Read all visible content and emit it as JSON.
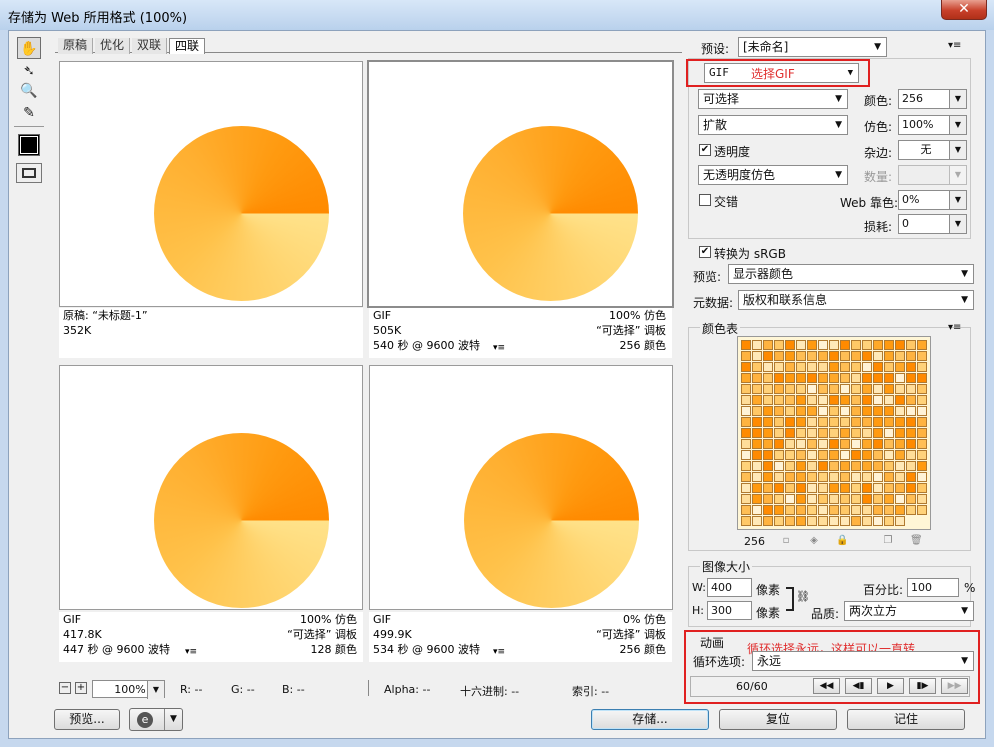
{
  "window": {
    "title": "存储为 Web 所用格式 (100%)",
    "close": "✕"
  },
  "tabs": [
    "原稿",
    "优化",
    "双联",
    "四联"
  ],
  "panes": [
    {
      "line1_left": "原稿: “未标题-1”",
      "line1_right": "",
      "line2_left": "352K",
      "line2_right": "",
      "line3_left": "",
      "line3_right": ""
    },
    {
      "line1_left": "GIF",
      "line1_right": "100% 仿色",
      "line2_left": "505K",
      "line2_right": "“可选择” 调板",
      "line3_left": "540 秒 @ 9600 波特",
      "line3_right": "256 颜色"
    },
    {
      "line1_left": "GIF",
      "line1_right": "100% 仿色",
      "line2_left": "417.8K",
      "line2_right": "“可选择” 调板",
      "line3_left": "447 秒 @ 9600 波特",
      "line3_right": "128 颜色"
    },
    {
      "line1_left": "GIF",
      "line1_right": "0% 仿色",
      "line2_left": "499.9K",
      "line2_right": "“可选择” 调板",
      "line3_left": "534 秒 @ 9600 波特",
      "line3_right": "256 颜色"
    }
  ],
  "status": {
    "zoom": "100%",
    "r": "R: --",
    "g": "G: --",
    "b": "B: --",
    "alpha": "Alpha: --",
    "hex": "十六进制: --",
    "index": "索引: --"
  },
  "buttons": {
    "preview": "预览...",
    "save": "存储...",
    "reset": "复位",
    "remember": "记住"
  },
  "settings": {
    "preset_label": "预设:",
    "preset_value": "[未命名]",
    "format_value": "GIF",
    "format_note": "选择GIF",
    "reduction": "可选择",
    "dither_algo": "扩散",
    "colors_label": "颜色:",
    "colors_value": "256",
    "dither_label": "仿色:",
    "dither_value": "100%",
    "transparency_label": "透明度",
    "matte_label": "杂边:",
    "matte_value": "无",
    "trans_dither": "无透明度仿色",
    "amount_label": "数量:",
    "interlaced_label": "交错",
    "websnap_label": "Web 靠色:",
    "websnap_value": "0%",
    "lossy_label": "损耗:",
    "lossy_value": "0",
    "convert_srgb": "转换为 sRGB",
    "preview_label": "预览:",
    "preview_value": "显示器颜色",
    "metadata_label": "元数据:",
    "metadata_value": "版权和联系信息"
  },
  "color_table": {
    "title": "颜色表",
    "count": "256"
  },
  "image_size": {
    "title": "图像大小",
    "w_label": "W:",
    "w_value": "400",
    "h_label": "H:",
    "h_value": "300",
    "unit": "像素",
    "percent_label": "百分比:",
    "percent_value": "100",
    "percent_unit": "%",
    "quality_label": "品质:",
    "quality_value": "两次立方"
  },
  "animation": {
    "title": "动画",
    "note": "循环选择永远，这样可以一直转",
    "loop_label": "循环选项:",
    "loop_value": "永远",
    "frame": "60/60"
  },
  "colors": {
    "accent_red": "#e02020",
    "pie_dark": "#ff8a00",
    "pie_light": "#ffe28a"
  }
}
